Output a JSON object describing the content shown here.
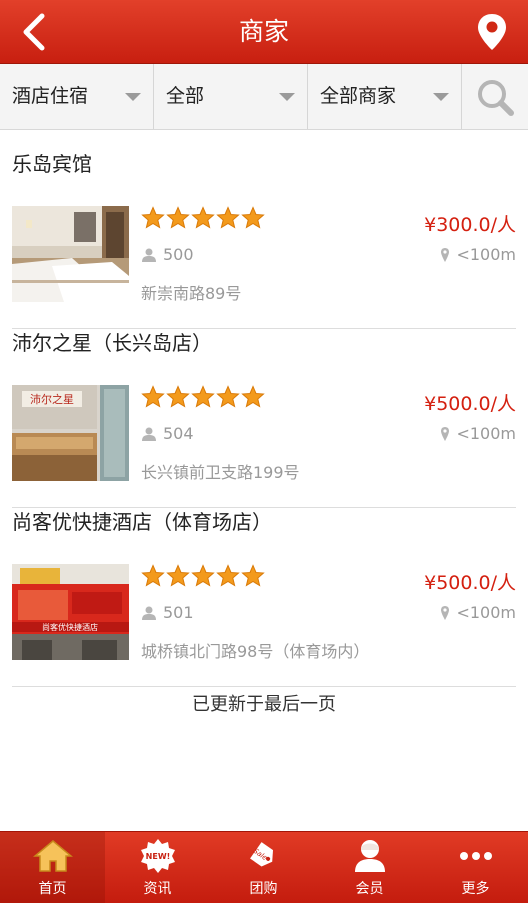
{
  "header": {
    "title": "商家",
    "back_icon": "back-chevron-icon",
    "location_icon": "location-pin-icon"
  },
  "filters": {
    "category": "酒店住宿",
    "area": "全部",
    "merchant": "全部商家",
    "search_icon": "search-icon"
  },
  "listings": [
    {
      "name": "乐岛宾馆",
      "stars": 5,
      "price": "¥300.0/人",
      "count": "500",
      "distance": "<100m",
      "address": "新崇南路89号"
    },
    {
      "name": "沛尔之星（长兴岛店）",
      "stars": 5,
      "price": "¥500.0/人",
      "count": "504",
      "distance": "<100m",
      "address": "长兴镇前卫支路199号"
    },
    {
      "name": "尚客优快捷酒店（体育场店）",
      "stars": 5,
      "price": "¥500.0/人",
      "count": "501",
      "distance": "<100m",
      "address": "城桥镇北门路98号（体育场内）"
    }
  ],
  "footer_note": "已更新于最后一页",
  "thumb_text": {
    "l1": "沛尔之星",
    "l3": "尚客优快捷酒店"
  },
  "tabs": [
    {
      "label": "首页",
      "icon": "home-icon",
      "active": true
    },
    {
      "label": "资讯",
      "icon": "news-badge-icon",
      "badge": "NEW!"
    },
    {
      "label": "团购",
      "icon": "sale-tag-icon",
      "badge": "Sale"
    },
    {
      "label": "会员",
      "icon": "member-icon"
    },
    {
      "label": "更多",
      "icon": "more-dots-icon"
    }
  ],
  "colors": {
    "brand_red": "#d42a16",
    "price_red": "#d42010",
    "star_orange": "#f39a1c"
  }
}
